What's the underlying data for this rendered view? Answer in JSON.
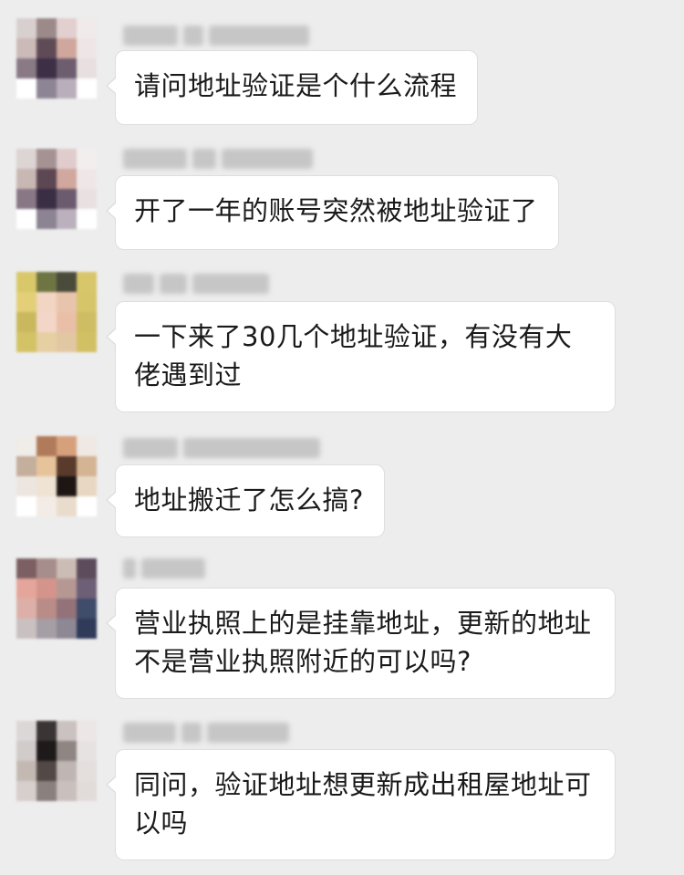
{
  "messages": [
    {
      "text": "请问地址验证是个什么流程",
      "avatar_colors": [
        "#d8d0cf",
        "#9c8a8a",
        "#e2cfcf",
        "#f0eaea",
        "#cbbab7",
        "#5f4b55",
        "#cfa79c",
        "#eee6e6",
        "#8a7a86",
        "#3c2f46",
        "#6e5d6f",
        "#e8e0e0",
        "#ffffff",
        "#8e8594",
        "#b9aebb",
        "#ffffff"
      ]
    },
    {
      "text": "开了一年的账号突然被地址验证了",
      "avatar_colors": [
        "#ddd4d4",
        "#a59292",
        "#e0cccc",
        "#f3eeee",
        "#c9b7b4",
        "#5c4752",
        "#d0a89e",
        "#efe7e7",
        "#887785",
        "#3a2e45",
        "#6c5b6e",
        "#e9e1e1",
        "#ffffff",
        "#8c8393",
        "#bbb0bd",
        "#ffffff"
      ]
    },
    {
      "text": "一下来了30几个地址验证，有没有大佬遇到过",
      "avatar_colors": [
        "#d9c86a",
        "#6e7442",
        "#4a4b3a",
        "#d8c66b",
        "#e3cf78",
        "#f2d5c2",
        "#e9c4ad",
        "#d7c56a",
        "#c9b85e",
        "#f4d6c8",
        "#e9bfa8",
        "#cfbd63",
        "#d3c266",
        "#e6cfa2",
        "#e2c7a3",
        "#d2c064"
      ]
    },
    {
      "text": "地址搬迁了怎么搞?",
      "avatar_colors": [
        "#f0ece8",
        "#b07b5a",
        "#d6a07d",
        "#efe8e3",
        "#c4ae9c",
        "#e7c39b",
        "#5a3b2b",
        "#d4b493",
        "#ede6e0",
        "#efe3d3",
        "#1d1613",
        "#e8d8c3",
        "#ffffff",
        "#f3ece6",
        "#e9dccc",
        "#ffffff"
      ]
    },
    {
      "text": "营业执照上的是挂靠地址，更新的地址不是营业执照附近的可以吗?",
      "avatar_colors": [
        "#7c5f63",
        "#a78d8c",
        "#cbbcb5",
        "#5d4c5c",
        "#e4a69a",
        "#d4948b",
        "#b69893",
        "#6d5f76",
        "#dcb0a9",
        "#b98c88",
        "#93727a",
        "#3f4c6a",
        "#c9c0c1",
        "#a59ea5",
        "#8d8894",
        "#2f3b59"
      ]
    },
    {
      "text": "同问，验证地址想更新成出租屋地址可以吗",
      "avatar_colors": [
        "#dcd7d7",
        "#3a3434",
        "#c9c2c1",
        "#ece6e6",
        "#d1cbc9",
        "#1e1a1a",
        "#8f8583",
        "#e7e2e2",
        "#c3b9b2",
        "#524947",
        "#bfb6b3",
        "#e4dedd",
        "#d6cfcc",
        "#8a807d",
        "#c9c0bd",
        "#e1dbda"
      ]
    }
  ]
}
